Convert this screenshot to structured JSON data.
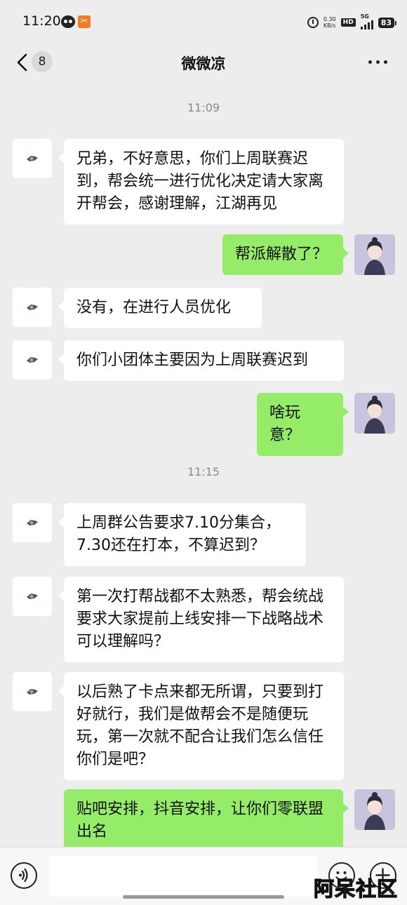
{
  "status_bar": {
    "time": "11:20",
    "net_speed_value": "0.30",
    "net_speed_unit": "KB/s",
    "hd": "HD",
    "network": "5G",
    "battery": "83"
  },
  "header": {
    "unread_count": "8",
    "title": "微微凉"
  },
  "messages": {
    "ts1": "11:09",
    "ts2": "11:15",
    "m1": "兄弟，不好意思，你们上周联赛迟到，帮会统一进行优化决定请大家离开帮会，感谢理解，江湖再见",
    "m2": "帮派解散了？",
    "m3": "没有，在进行人员优化",
    "m4": "你们小团体主要因为上周联赛迟到",
    "m5": "啥玩意？",
    "m6": "上周群公告要求7.10分集合，7.30还在打本，不算迟到？",
    "m7": "第一次打帮战都不太熟悉，帮会统战要求大家提前上线安排一下战略战术可以理解吗？",
    "m8": "以后熟了卡点来都无所谓，只要到打好就行，我们是做帮会不是随便玩玩，第一次就不配合让我们怎么信任你们是吧？",
    "m9": "贴吧安排，抖音安排，让你们零联盟出名"
  },
  "input_bar": {
    "text_value": ""
  },
  "watermark": "阿呆社区",
  "colors": {
    "background": "#ededed",
    "incoming_bubble": "#ffffff",
    "outgoing_bubble": "#95ec69"
  }
}
